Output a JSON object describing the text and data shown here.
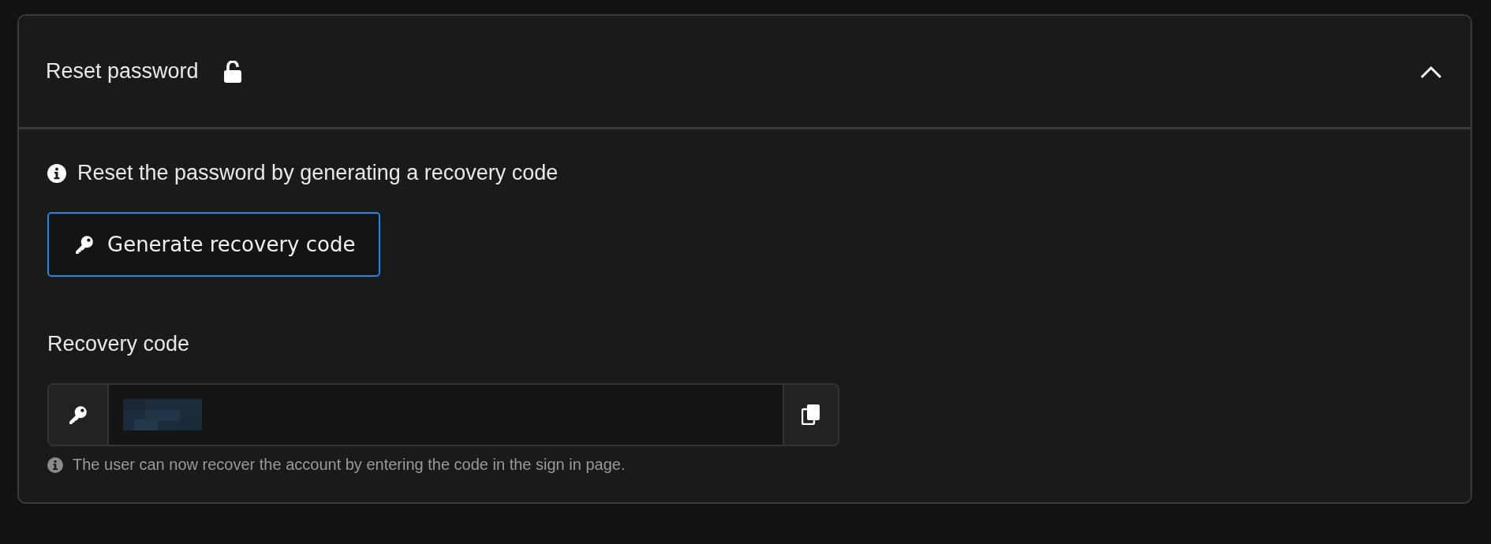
{
  "panel": {
    "title": "Reset password",
    "expanded": true
  },
  "info": {
    "text": "Reset the password by generating a recovery code"
  },
  "generate_button": {
    "label": "Generate recovery code"
  },
  "recovery_code": {
    "label": "Recovery code",
    "value_redacted": true,
    "help": "The user can now recover the account by entering the code in the sign in page."
  }
}
